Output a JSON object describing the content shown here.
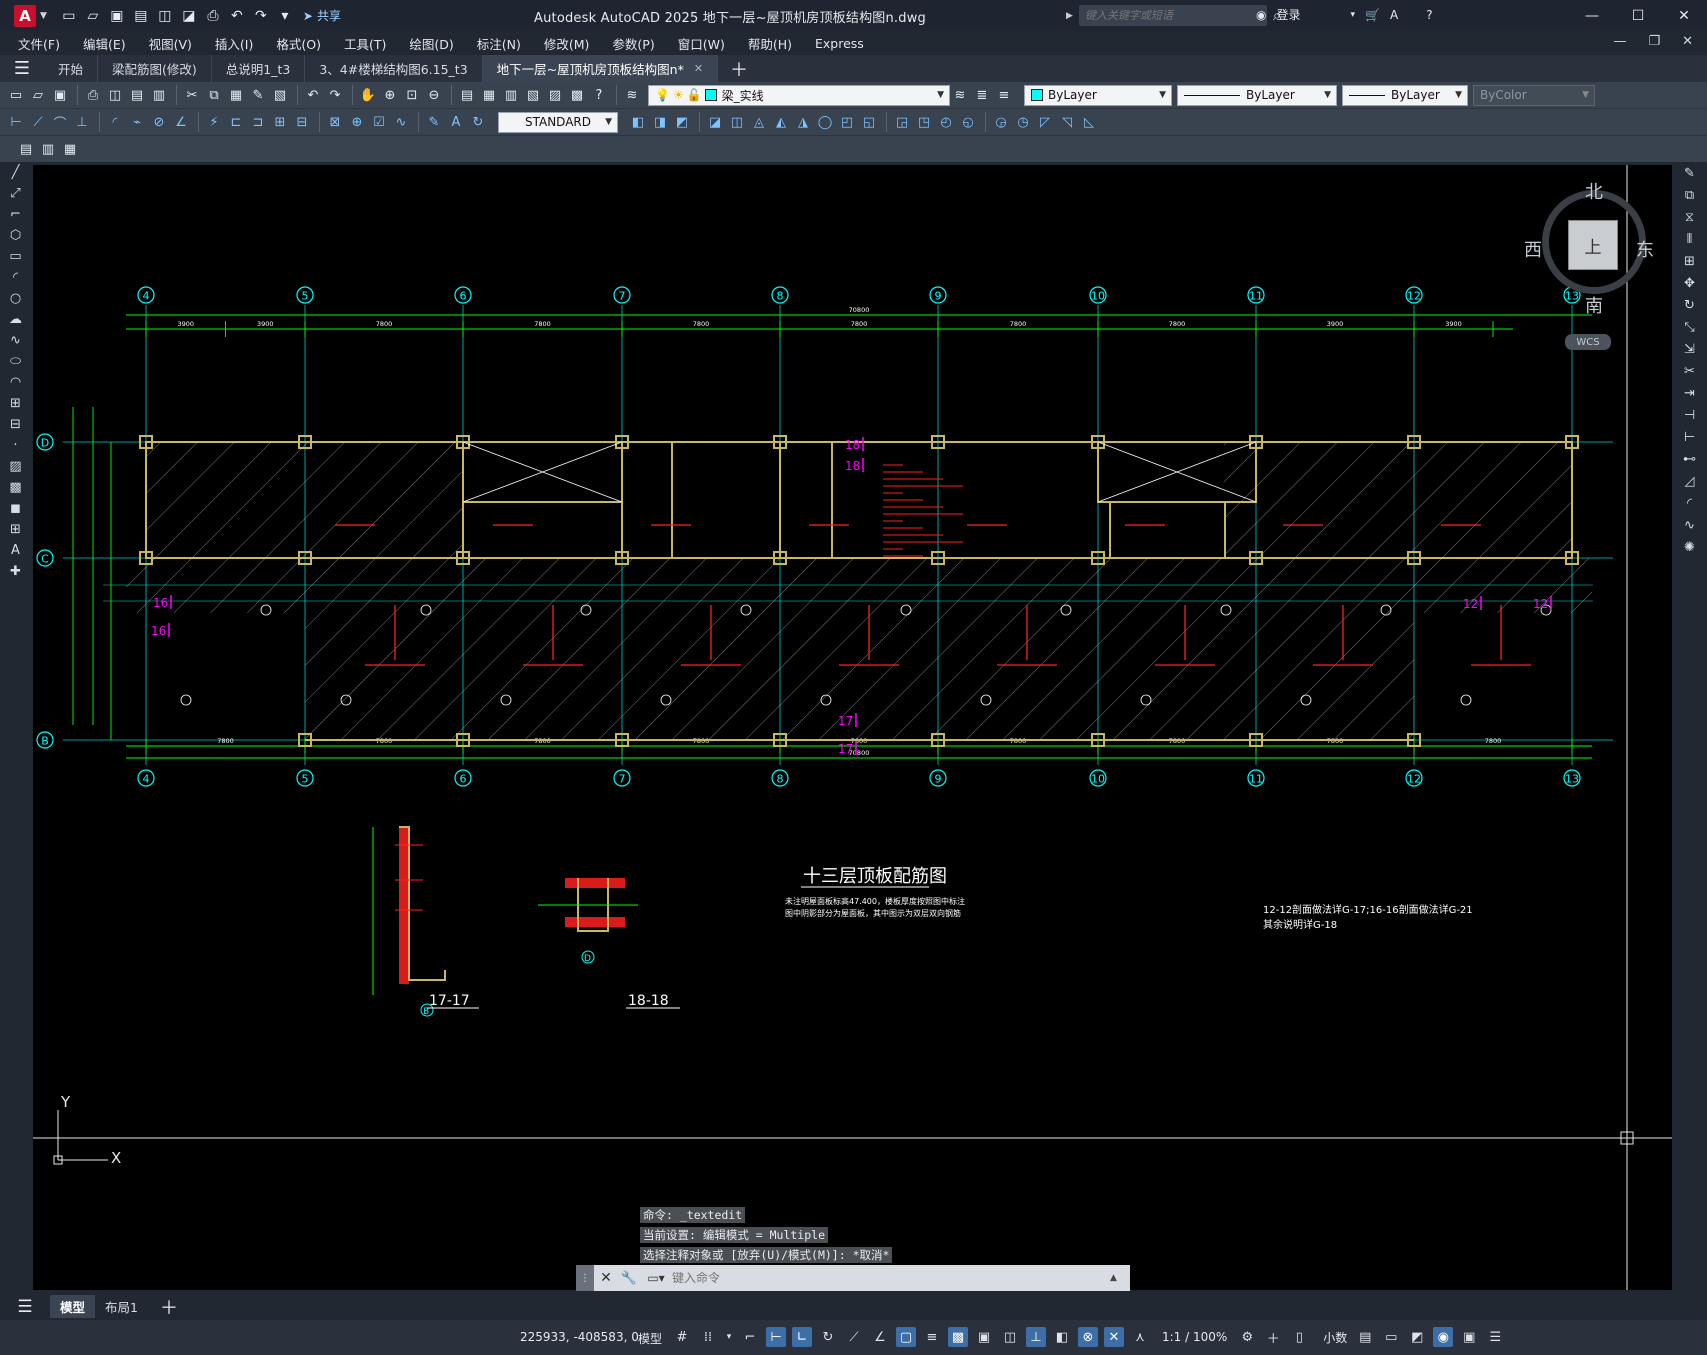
{
  "app": {
    "logo_letter": "A",
    "share_label": "共享",
    "window_title": "Autodesk AutoCAD 2025    地下一层~屋顶机房顶板结构图n.dwg",
    "search_placeholder": "键入关键字或短语",
    "login_label": "登录"
  },
  "menu": [
    "文件(F)",
    "编辑(E)",
    "视图(V)",
    "插入(I)",
    "格式(O)",
    "工具(T)",
    "绘图(D)",
    "标注(N)",
    "修改(M)",
    "参数(P)",
    "窗口(W)",
    "帮助(H)",
    "Express"
  ],
  "file_tabs": [
    {
      "label": "开始",
      "active": false
    },
    {
      "label": "梁配筋图(修改)",
      "active": false
    },
    {
      "label": "总说明1_t3",
      "active": false
    },
    {
      "label": "3、4#楼梯结构图6.15_t3",
      "active": false
    },
    {
      "label": "地下一层~屋顶机房顶板结构图n*",
      "active": true
    }
  ],
  "properties": {
    "layer_name": "梁_实线",
    "color": "ByLayer",
    "linetype": "ByLayer",
    "lineweight": "ByLayer",
    "plotstyle": "ByColor",
    "text_style": "STANDARD"
  },
  "viewcube": {
    "north": "北",
    "south": "南",
    "east": "东",
    "west": "西",
    "face": "上",
    "wcs": "WCS"
  },
  "drawing": {
    "grid_columns": [
      "4",
      "5",
      "6",
      "7",
      "8",
      "9",
      "10",
      "11",
      "12",
      "13"
    ],
    "grid_rows": [
      "D",
      "C",
      "B"
    ],
    "overall_dim": "70800",
    "top_dims": [
      "3900",
      "3900",
      "7800",
      "7800",
      "7800",
      "7800",
      "7800",
      "7800",
      "3900",
      "3900"
    ],
    "bottom_dims": [
      "7800",
      "7800",
      "7800",
      "7800",
      "7800",
      "7800",
      "7800",
      "7800",
      "7800"
    ],
    "sheet_title": "十三层顶板配筋图",
    "sheet_note_1": "未注明屋面板标高47.400，楼板厚度按照图中标注",
    "sheet_note_2": "图中阴影部分为屋面板，其中图示为双层双向钢筋",
    "section_note_1": "12-12剖面做法详G-17;16-16剖面做法详G-21",
    "section_note_2": "其余说明详G-18",
    "section_a": "17-17",
    "section_b": "18-18",
    "section_a_axis": "B",
    "section_b_axis": "D",
    "callouts": [
      "16",
      "16",
      "17",
      "17",
      "18",
      "18",
      "12",
      "12"
    ]
  },
  "command_history": [
    "命令: _textedit",
    "当前设置: 编辑模式 = Multiple",
    "选择注释对象或 [放弃(U)/模式(M)]: *取消*"
  ],
  "command_placeholder": "键入命令",
  "layout_tabs": [
    {
      "label": "模型",
      "active": true
    },
    {
      "label": "布局1",
      "active": false
    }
  ],
  "status": {
    "coordinates": "225933, -408583, 0",
    "space": "模型",
    "scale": "1:1 / 100%",
    "units": "小数"
  },
  "colors": {
    "canvas": "#000000",
    "grid": "#00ffff",
    "wall": "#c8b95a",
    "rebar": "#ff2020",
    "dim": "#00ff00",
    "callout": "#ff00ff",
    "brand": "#c8102e"
  }
}
